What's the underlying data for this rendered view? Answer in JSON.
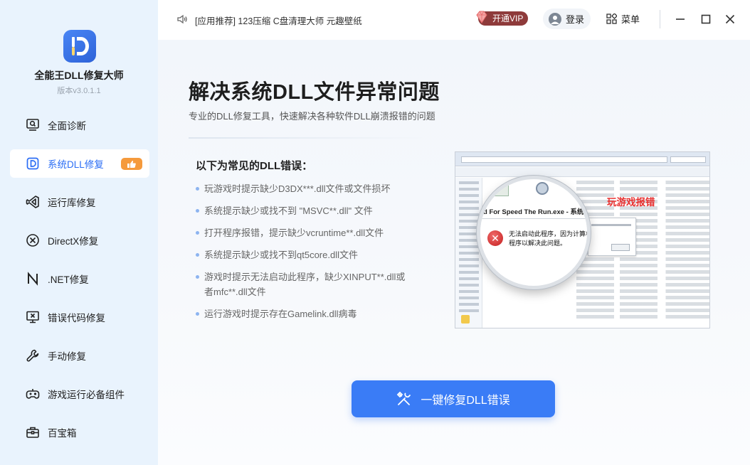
{
  "app": {
    "name": "全能王DLL修复大师",
    "version": "版本v3.0.1.1",
    "brand_color": "#2c6ef5"
  },
  "sidebar": {
    "items": [
      {
        "label": "全面诊断",
        "icon": "diagnosis-monitor-icon",
        "active": false
      },
      {
        "label": "系统DLL修复",
        "icon": "dll-d-icon",
        "active": true,
        "badge_icon": "thumbs-up-icon"
      },
      {
        "label": "运行库修复",
        "icon": "visual-studio-icon",
        "active": false
      },
      {
        "label": "DirectX修复",
        "icon": "directx-icon",
        "active": false
      },
      {
        "label": ".NET修复",
        "icon": "dotnet-n-icon",
        "active": false
      },
      {
        "label": "错误代码修复",
        "icon": "error-monitor-icon",
        "active": false
      },
      {
        "label": "手动修复",
        "icon": "wrench-icon",
        "active": false
      },
      {
        "label": "游戏运行必备组件",
        "icon": "gamepad-icon",
        "active": false
      },
      {
        "label": "百宝箱",
        "icon": "toolbox-icon",
        "active": false
      }
    ]
  },
  "titlebar": {
    "notice": "[应用推荐] 123压缩 C盘清理大师 元趣壁纸",
    "vip_label": "开通VIP",
    "login_label": "登录",
    "menu_label": "菜单"
  },
  "main": {
    "headline": "解决系统DLL文件异常问题",
    "subline": "专业的DLL修复工具，快速解决各种软件DLL崩溃报错的问题",
    "errors_title": "以下为常见的DLL错误：",
    "errors": [
      "玩游戏时提示缺少D3DX***.dll文件或文件损坏",
      "系统提示缺少或找不到 \"MSVC**.dll\" 文件",
      "打开程序报错，提示缺少vcruntime**.dll文件",
      "系统提示缺少或找不到qt5core.dll文件",
      "游戏时提示无法启动此程序，缺少XINPUT**.dll或者mfc**.dll文件",
      "运行游戏时提示存在Gamelink.dll病毒"
    ],
    "illustration": {
      "game_label": "玩游戏报错",
      "window_title": "d For Speed The Run.exe - 系统错误",
      "message_line1": "无法启动此程序，因为计算机中",
      "message_line2": "程序以解决此问题。"
    },
    "fix_button_label": "一键修复DLL错误"
  }
}
